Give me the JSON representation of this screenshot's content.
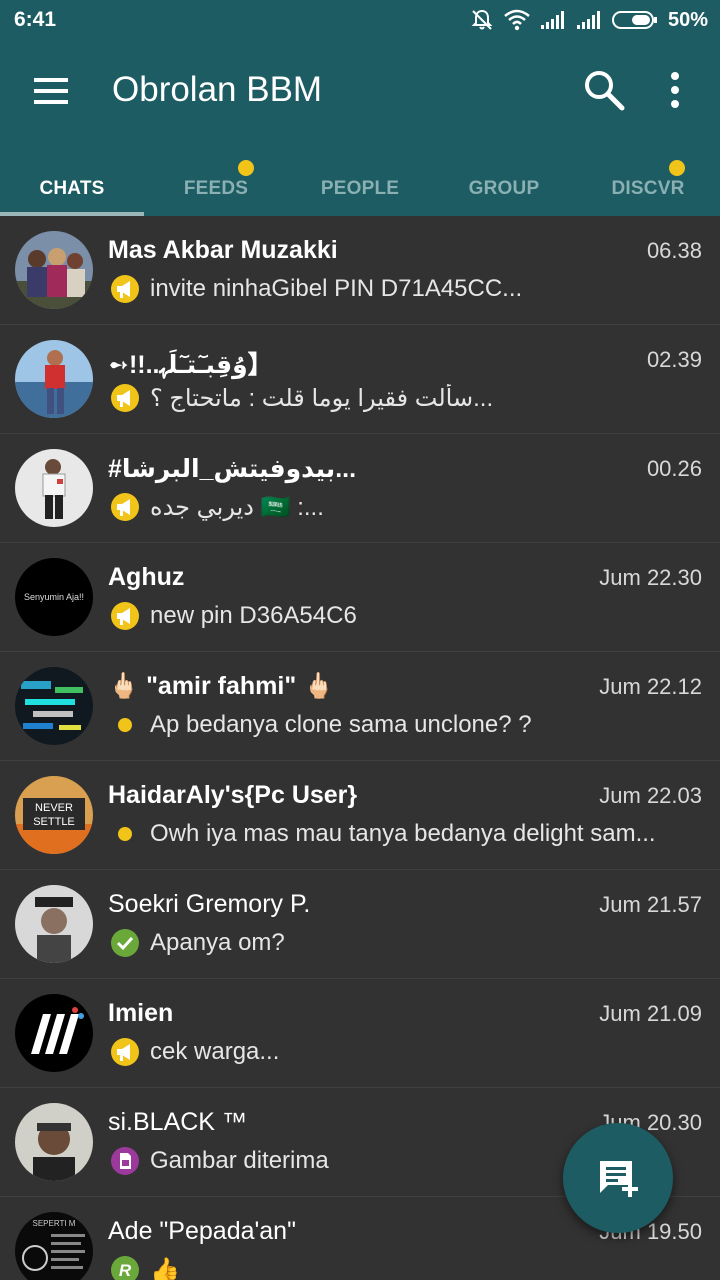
{
  "status_bar": {
    "time": "6:41",
    "battery_percent": "50%",
    "icons": [
      "mute-icon",
      "wifi-icon",
      "signal-icon",
      "signal-icon",
      "battery-icon"
    ]
  },
  "app_bar": {
    "title": "Obrolan BBM",
    "menu_icon": "menu-icon",
    "search_icon": "search-icon",
    "more_icon": "more-vert-icon",
    "background": "#1c5c62"
  },
  "tabs": [
    {
      "label": "CHATS",
      "active": true,
      "has_dot": false
    },
    {
      "label": "FEEDS",
      "active": false,
      "has_dot": true
    },
    {
      "label": "PEOPLE",
      "active": false,
      "has_dot": false
    },
    {
      "label": "GROUP",
      "active": false,
      "has_dot": false
    },
    {
      "label": "DISCVR",
      "active": false,
      "has_dot": true
    }
  ],
  "chats": [
    {
      "name": "Mas Akbar Muzakki",
      "time": "06.38",
      "message": "invite ninhaGibel PIN  D71A45CC...",
      "icon": "broadcast-icon"
    },
    {
      "name": "➻!!..ﻭُﻗِﺒـٓﺘـٓﻠَﮩ】",
      "time": "02.39",
      "message": "سألت فقيرا يوما قلت : ماتحتاج ؟...",
      "icon": "broadcast-icon"
    },
    {
      "name": "#بيدوفيتش_البرشا...",
      "time": "00.26",
      "message": "ديربي جده 🇸🇦 :...",
      "icon": "broadcast-icon"
    },
    {
      "name": "Aghuz",
      "time": "Jum 22.30",
      "message": "new pin D36A54C6",
      "icon": "broadcast-icon"
    },
    {
      "name": "🖕🏻 \"amir fahmi\" 🖕🏻",
      "time": "Jum 22.12",
      "message": "Ap bedanya clone sama unclone? ?",
      "icon": "unread-dot-icon"
    },
    {
      "name": "HaidarAly's{Pc User}",
      "time": "Jum 22.03",
      "message": "Owh iya mas mau tanya bedanya delight sam...",
      "icon": "unread-dot-icon"
    },
    {
      "name": "Soekri Gremory P.",
      "time": "Jum 21.57",
      "message": "Apanya om?",
      "icon": "read-check-icon"
    },
    {
      "name": "Imien",
      "time": "Jum 21.09",
      "message": "cek warga...",
      "icon": "broadcast-icon"
    },
    {
      "name": "si.BLACK ™",
      "time": "Jum 20.30",
      "message": "Gambar diterima",
      "icon": "picture-received-icon"
    },
    {
      "name": "Ade \"Pepada'an\"",
      "time": "Jum 19.50",
      "message": "👍",
      "icon": "r-status-icon"
    }
  ],
  "avatar_text": {
    "aghuz": "Senyumin Aja!!",
    "haidar_line1": "NEVER",
    "haidar_line2": "SETTLE",
    "ade": "SEPERTI M"
  },
  "fab": {
    "icon": "new-chat-icon"
  },
  "colors": {
    "accent_yellow": "#f0c419",
    "list_background": "#323232",
    "check_green": "#6aa83a",
    "picture_purple": "#9c3a9c"
  }
}
